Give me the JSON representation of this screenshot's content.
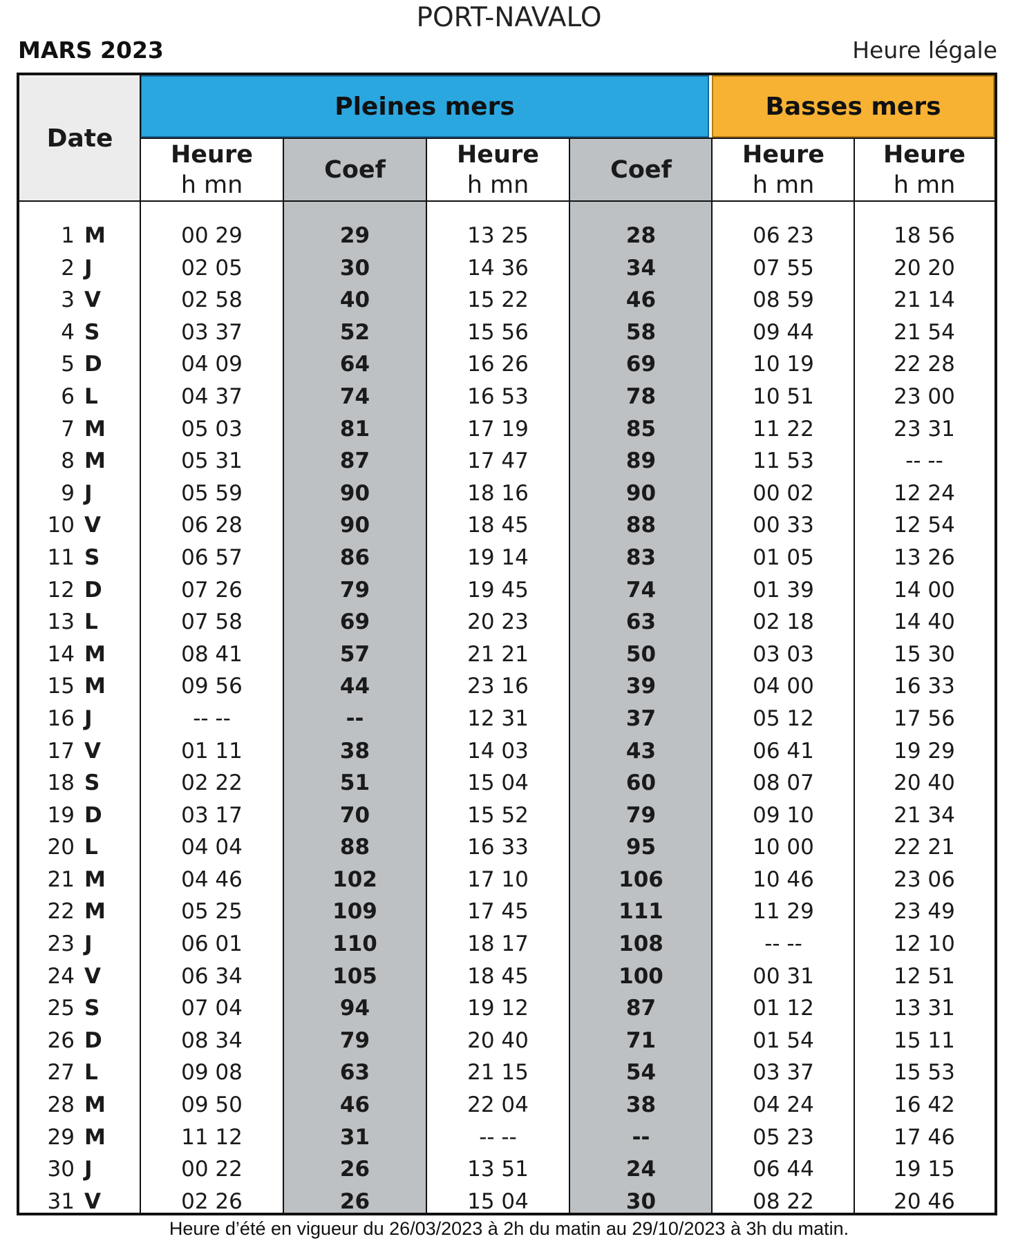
{
  "header": {
    "port": "PORT-NAVALO",
    "month": "MARS 2023",
    "time_ref": "Heure légale"
  },
  "table": {
    "date_label": "Date",
    "pleines_label": "Pleines mers",
    "basses_label": "Basses mers",
    "heure_label": "Heure",
    "unit_label": "h mn",
    "coef_label": "Coef",
    "colors": {
      "pleines": "#2ba7e0",
      "basses": "#f7b233",
      "coef_bg": "#bdc1c4",
      "date_bg": "#ececec"
    },
    "rows": [
      {
        "day": "1",
        "wd": "M",
        "pm1": "00 29",
        "c1": "29",
        "pm2": "13 25",
        "c2": "28",
        "bm1": "06 23",
        "bm2": "18 56"
      },
      {
        "day": "2",
        "wd": "J",
        "pm1": "02 05",
        "c1": "30",
        "pm2": "14 36",
        "c2": "34",
        "bm1": "07 55",
        "bm2": "20 20"
      },
      {
        "day": "3",
        "wd": "V",
        "pm1": "02 58",
        "c1": "40",
        "pm2": "15 22",
        "c2": "46",
        "bm1": "08 59",
        "bm2": "21 14"
      },
      {
        "day": "4",
        "wd": "S",
        "pm1": "03 37",
        "c1": "52",
        "pm2": "15 56",
        "c2": "58",
        "bm1": "09 44",
        "bm2": "21 54"
      },
      {
        "day": "5",
        "wd": "D",
        "pm1": "04 09",
        "c1": "64",
        "pm2": "16 26",
        "c2": "69",
        "bm1": "10 19",
        "bm2": "22 28"
      },
      {
        "day": "6",
        "wd": "L",
        "pm1": "04 37",
        "c1": "74",
        "pm2": "16 53",
        "c2": "78",
        "bm1": "10 51",
        "bm2": "23 00"
      },
      {
        "day": "7",
        "wd": "M",
        "pm1": "05 03",
        "c1": "81",
        "pm2": "17 19",
        "c2": "85",
        "bm1": "11 22",
        "bm2": "23 31"
      },
      {
        "day": "8",
        "wd": "M",
        "pm1": "05 31",
        "c1": "87",
        "pm2": "17 47",
        "c2": "89",
        "bm1": "11 53",
        "bm2": "-- --"
      },
      {
        "day": "9",
        "wd": "J",
        "pm1": "05 59",
        "c1": "90",
        "pm2": "18 16",
        "c2": "90",
        "bm1": "00 02",
        "bm2": "12 24"
      },
      {
        "day": "10",
        "wd": "V",
        "pm1": "06 28",
        "c1": "90",
        "pm2": "18 45",
        "c2": "88",
        "bm1": "00 33",
        "bm2": "12 54"
      },
      {
        "day": "11",
        "wd": "S",
        "pm1": "06 57",
        "c1": "86",
        "pm2": "19 14",
        "c2": "83",
        "bm1": "01 05",
        "bm2": "13 26"
      },
      {
        "day": "12",
        "wd": "D",
        "pm1": "07 26",
        "c1": "79",
        "pm2": "19 45",
        "c2": "74",
        "bm1": "01 39",
        "bm2": "14 00"
      },
      {
        "day": "13",
        "wd": "L",
        "pm1": "07 58",
        "c1": "69",
        "pm2": "20 23",
        "c2": "63",
        "bm1": "02 18",
        "bm2": "14 40"
      },
      {
        "day": "14",
        "wd": "M",
        "pm1": "08 41",
        "c1": "57",
        "pm2": "21 21",
        "c2": "50",
        "bm1": "03 03",
        "bm2": "15 30"
      },
      {
        "day": "15",
        "wd": "M",
        "pm1": "09 56",
        "c1": "44",
        "pm2": "23 16",
        "c2": "39",
        "bm1": "04 00",
        "bm2": "16 33"
      },
      {
        "day": "16",
        "wd": "J",
        "pm1": "-- --",
        "c1": "--",
        "pm2": "12 31",
        "c2": "37",
        "bm1": "05 12",
        "bm2": "17 56"
      },
      {
        "day": "17",
        "wd": "V",
        "pm1": "01 11",
        "c1": "38",
        "pm2": "14 03",
        "c2": "43",
        "bm1": "06 41",
        "bm2": "19 29"
      },
      {
        "day": "18",
        "wd": "S",
        "pm1": "02 22",
        "c1": "51",
        "pm2": "15 04",
        "c2": "60",
        "bm1": "08 07",
        "bm2": "20 40"
      },
      {
        "day": "19",
        "wd": "D",
        "pm1": "03 17",
        "c1": "70",
        "pm2": "15 52",
        "c2": "79",
        "bm1": "09 10",
        "bm2": "21 34"
      },
      {
        "day": "20",
        "wd": "L",
        "pm1": "04 04",
        "c1": "88",
        "pm2": "16 33",
        "c2": "95",
        "bm1": "10 00",
        "bm2": "22 21"
      },
      {
        "day": "21",
        "wd": "M",
        "pm1": "04 46",
        "c1": "102",
        "pm2": "17 10",
        "c2": "106",
        "bm1": "10 46",
        "bm2": "23 06"
      },
      {
        "day": "22",
        "wd": "M",
        "pm1": "05 25",
        "c1": "109",
        "pm2": "17 45",
        "c2": "111",
        "bm1": "11 29",
        "bm2": "23 49"
      },
      {
        "day": "23",
        "wd": "J",
        "pm1": "06 01",
        "c1": "110",
        "pm2": "18 17",
        "c2": "108",
        "bm1": "-- --",
        "bm2": "12 10"
      },
      {
        "day": "24",
        "wd": "V",
        "pm1": "06 34",
        "c1": "105",
        "pm2": "18 45",
        "c2": "100",
        "bm1": "00 31",
        "bm2": "12 51"
      },
      {
        "day": "25",
        "wd": "S",
        "pm1": "07 04",
        "c1": "94",
        "pm2": "19 12",
        "c2": "87",
        "bm1": "01 12",
        "bm2": "13 31"
      },
      {
        "day": "26",
        "wd": "D",
        "pm1": "08 34",
        "c1": "79",
        "pm2": "20 40",
        "c2": "71",
        "bm1": "01 54",
        "bm2": "15 11"
      },
      {
        "day": "27",
        "wd": "L",
        "pm1": "09 08",
        "c1": "63",
        "pm2": "21 15",
        "c2": "54",
        "bm1": "03 37",
        "bm2": "15 53"
      },
      {
        "day": "28",
        "wd": "M",
        "pm1": "09 50",
        "c1": "46",
        "pm2": "22 04",
        "c2": "38",
        "bm1": "04 24",
        "bm2": "16 42"
      },
      {
        "day": "29",
        "wd": "M",
        "pm1": "11 12",
        "c1": "31",
        "pm2": "-- --",
        "c2": "--",
        "bm1": "05 23",
        "bm2": "17 46"
      },
      {
        "day": "30",
        "wd": "J",
        "pm1": "00 22",
        "c1": "26",
        "pm2": "13 51",
        "c2": "24",
        "bm1": "06 44",
        "bm2": "19 15"
      },
      {
        "day": "31",
        "wd": "V",
        "pm1": "02 26",
        "c1": "26",
        "pm2": "15 04",
        "c2": "30",
        "bm1": "08 22",
        "bm2": "20 46"
      }
    ]
  },
  "footnote": "Heure d’été en vigueur du 26/03/2023 à 2h du matin au 29/10/2023 à 3h du matin."
}
